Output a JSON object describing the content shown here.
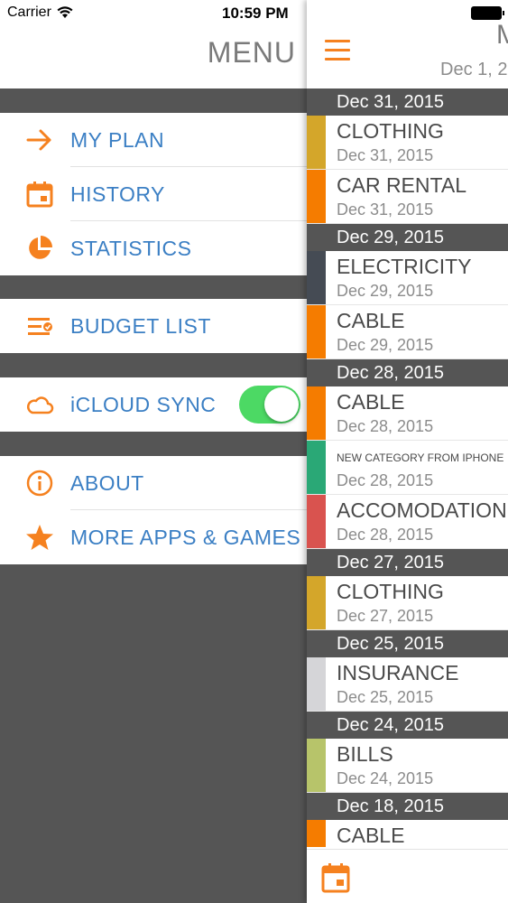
{
  "status_bar": {
    "carrier": "Carrier",
    "time": "10:59 PM"
  },
  "colors": {
    "accent": "#f5811f",
    "link": "#3b7fc4",
    "toggle_on": "#4cd964",
    "dark": "#555555"
  },
  "menu": {
    "title": "MENU",
    "items": [
      {
        "label": "MY PLAN",
        "icon": "arrow-right-icon"
      },
      {
        "label": "HISTORY",
        "icon": "calendar-icon"
      },
      {
        "label": "STATISTICS",
        "icon": "pie-chart-icon"
      },
      {
        "label": "BUDGET LIST",
        "icon": "list-check-icon"
      },
      {
        "label": "iCLOUD SYNC",
        "icon": "cloud-icon",
        "toggle_on": true
      },
      {
        "label": "ABOUT",
        "icon": "info-icon"
      },
      {
        "label": "MORE APPS & GAMES",
        "icon": "star-icon"
      }
    ]
  },
  "panel": {
    "title": "M",
    "subtitle": "Dec 1, 2",
    "sections": [
      {
        "date": "Dec 31, 2015",
        "entries": [
          {
            "category": "CLOTHING",
            "date": "Dec 31, 2015",
            "color": "#d4a62a"
          },
          {
            "category": "CAR RENTAL",
            "date": "Dec 31, 2015",
            "color": "#f57c00"
          }
        ]
      },
      {
        "date": "Dec 29, 2015",
        "entries": [
          {
            "category": "ELECTRICITY",
            "date": "Dec 29, 2015",
            "color": "#454b54"
          },
          {
            "category": "CABLE",
            "date": "Dec 29, 2015",
            "color": "#f57c00"
          }
        ]
      },
      {
        "date": "Dec 28, 2015",
        "entries": [
          {
            "category": "CABLE",
            "date": "Dec 28, 2015",
            "color": "#f57c00"
          },
          {
            "category": "NEW CATEGORY FROM IPHONE",
            "date": "Dec 28, 2015",
            "color": "#2aa876"
          },
          {
            "category": "ACCOMODATION",
            "date": "Dec 28, 2015",
            "color": "#d9534f"
          }
        ]
      },
      {
        "date": "Dec 27, 2015",
        "entries": [
          {
            "category": "CLOTHING",
            "date": "Dec 27, 2015",
            "color": "#d4a62a"
          }
        ]
      },
      {
        "date": "Dec 25, 2015",
        "entries": [
          {
            "category": "INSURANCE",
            "date": "Dec 25, 2015",
            "color": "#d5d5d8"
          }
        ]
      },
      {
        "date": "Dec 24, 2015",
        "entries": [
          {
            "category": "BILLS",
            "date": "Dec 24, 2015",
            "color": "#b7c46a"
          }
        ]
      },
      {
        "date": "Dec 18, 2015",
        "entries": [
          {
            "category": "CABLE",
            "date": "",
            "color": "#f57c00"
          }
        ]
      }
    ]
  },
  "tabbar": {
    "icon": "calendar-icon"
  }
}
